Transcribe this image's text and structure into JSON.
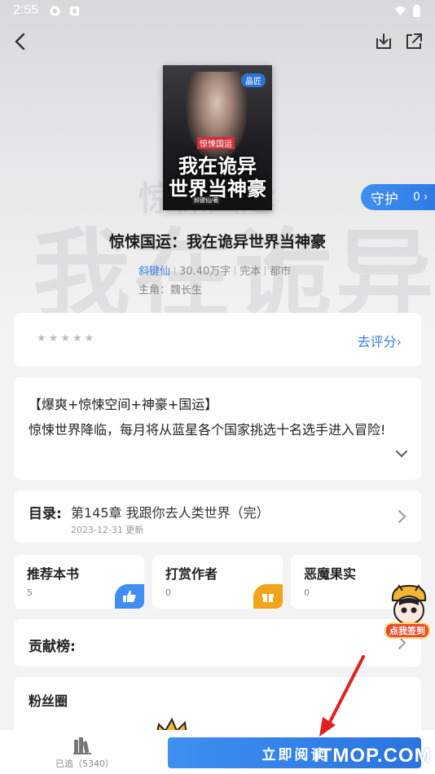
{
  "status_bar": {
    "time": "2:55"
  },
  "book": {
    "title": "惊悚国运：我在诡异世界当神豪",
    "author": "斜键仙",
    "word_count": "30.40万字",
    "status": "完本",
    "category": "都市",
    "protagonist": "主角：魏长生"
  },
  "cover": {
    "badge": "晶匠",
    "tag": "惊悚国运",
    "title_line1": "我在诡异",
    "title_line2": "世界当神豪",
    "author_line": "斜键仙/著"
  },
  "guard": {
    "label": "守护",
    "count": "0",
    "arrow": "›"
  },
  "rating": {
    "stars": [
      "★",
      "★",
      "★",
      "★",
      "★"
    ],
    "link": "去评分›"
  },
  "intro": {
    "tags": "【爆爽+惊悚空间+神豪+国运】",
    "text": "惊悚世界降临，每月将从蓝星各个国家挑选十名选手进入冒险!"
  },
  "toc": {
    "label": "目录:",
    "chapter": "第145章 我跟你去人类世界（完）",
    "date": "2023-12-31 更新"
  },
  "mini_cards": [
    {
      "title": "推荐本书",
      "value": "5",
      "badge_icon": "thumb-up-icon",
      "color": "#3f8ff0"
    },
    {
      "title": "打赏作者",
      "value": "0",
      "badge_icon": "gift-icon",
      "color": "#f2a51a"
    },
    {
      "title": "恶魔果实",
      "value": "0",
      "badge_icon": "",
      "color": "#ffffff"
    }
  ],
  "contrib": {
    "label": "贡献榜:"
  },
  "fans": {
    "label": "粉丝圈"
  },
  "signin": {
    "label": "点我签到"
  },
  "bottom": {
    "shelf_label": "已追（5340）",
    "read_button": "立即阅读"
  },
  "watermark": {
    "text": "ITMOP.COM"
  },
  "colors": {
    "accent": "#3a7ee0",
    "background": "#f3f3f4"
  }
}
